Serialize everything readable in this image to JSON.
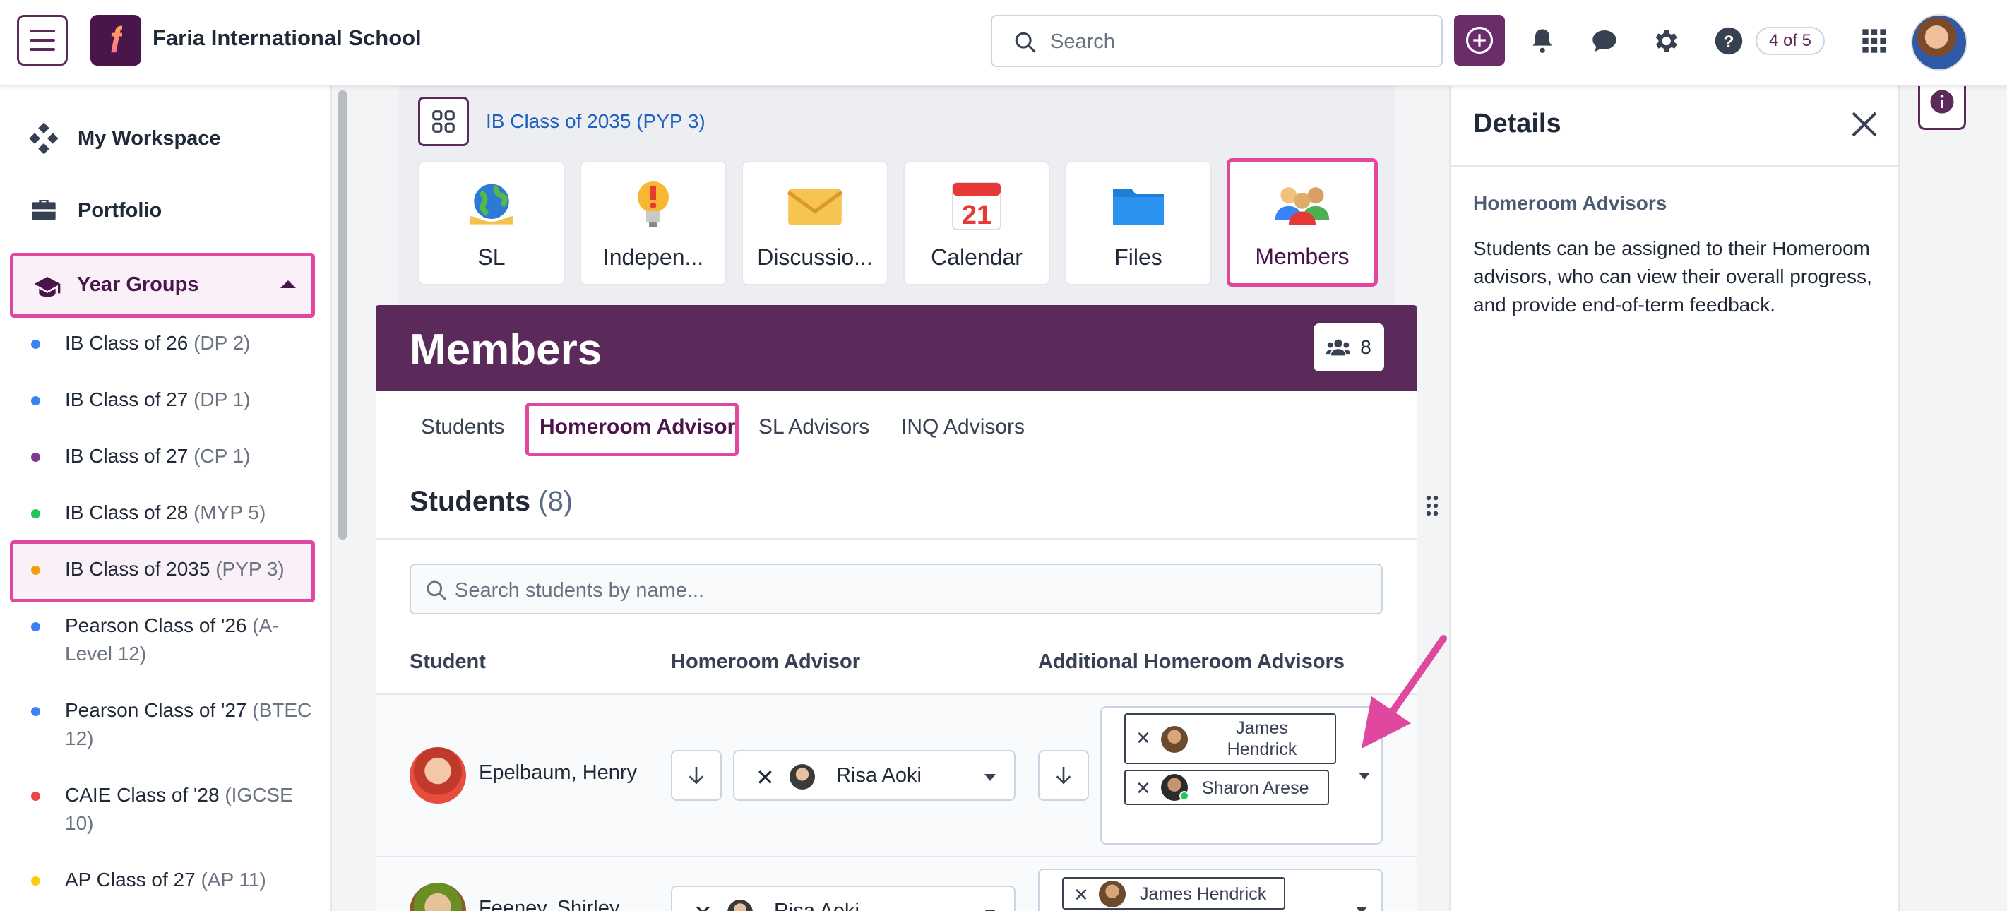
{
  "header": {
    "school_name": "Faria International School",
    "search_placeholder": "Search",
    "counter": "4 of 5",
    "icons": [
      "menu-icon",
      "plus-circle-icon",
      "bell-icon",
      "chat-icon",
      "gear-icon",
      "help-icon",
      "apps-grid-icon"
    ]
  },
  "sidebar": {
    "items": [
      {
        "label": "My Workspace",
        "icon": "diamond-grid-icon"
      },
      {
        "label": "Portfolio",
        "icon": "briefcase-icon"
      }
    ],
    "section": {
      "label": "Year Groups",
      "icon": "graduation-cap-icon"
    },
    "classes": [
      {
        "main": "IB Class of 26 ",
        "sub": "(DP 2)",
        "color": "#3b82f6"
      },
      {
        "main": "IB Class of 27 ",
        "sub": "(DP 1)",
        "color": "#3b82f6"
      },
      {
        "main": "IB Class of 27 ",
        "sub": "(CP 1)",
        "color": "#7e3a8f"
      },
      {
        "main": "IB Class of 28 ",
        "sub": "(MYP 5)",
        "color": "#22c55e"
      },
      {
        "main": "IB Class of 2035 ",
        "sub": "(PYP 3)",
        "color": "#f59e0b"
      },
      {
        "main": "Pearson Class of '26 ",
        "sub": "(A-Level 12)",
        "color": "#3b82f6"
      },
      {
        "main": "Pearson Class of '27 ",
        "sub": "(BTEC 12)",
        "color": "#3b82f6"
      },
      {
        "main": "CAIE Class of '28 ",
        "sub": "(IGCSE 10)",
        "color": "#ef4444"
      },
      {
        "main": "AP Class of 27 ",
        "sub": "(AP 11)",
        "color": "#facc15"
      }
    ]
  },
  "group": {
    "link": "IB Class of 2035 (PYP 3)",
    "tiles": [
      {
        "label": "SL",
        "icon": "globe-hands-icon"
      },
      {
        "label": "Indepen...",
        "icon": "lightbulb-icon"
      },
      {
        "label": "Discussio...",
        "icon": "envelope-icon"
      },
      {
        "label": "Calendar",
        "icon": "calendar-icon",
        "day": "21"
      },
      {
        "label": "Files",
        "icon": "folder-icon"
      },
      {
        "label": "Members",
        "icon": "people-group-icon"
      }
    ]
  },
  "members": {
    "title": "Members",
    "count": "8",
    "tabs": [
      "Students",
      "Homeroom Advisor",
      "SL Advisors",
      "INQ Advisors"
    ],
    "students_heading": "Students",
    "students_count": "(8)",
    "search_placeholder": "Search students by name...",
    "columns": [
      "Student",
      "Homeroom Advisor",
      "Additional Homeroom Advisors"
    ],
    "rows": [
      {
        "student": "Epelbaum, Henry",
        "advisor": "Risa Aoki",
        "additional": [
          "James Hendrick",
          "Sharon Arese"
        ]
      },
      {
        "student": "Feeney, Shirley",
        "advisor": "Risa Aoki",
        "additional": [
          "James Hendrick"
        ]
      }
    ]
  },
  "details": {
    "title": "Details",
    "subtitle": "Homeroom Advisors",
    "body": "Students can be assigned to their Homeroom advisors, who can view their overall progress, and provide end-of-term feedback."
  },
  "colors": {
    "brand": "#5b2a5a",
    "highlight": "#e0479e",
    "link": "#1f5fbf"
  }
}
